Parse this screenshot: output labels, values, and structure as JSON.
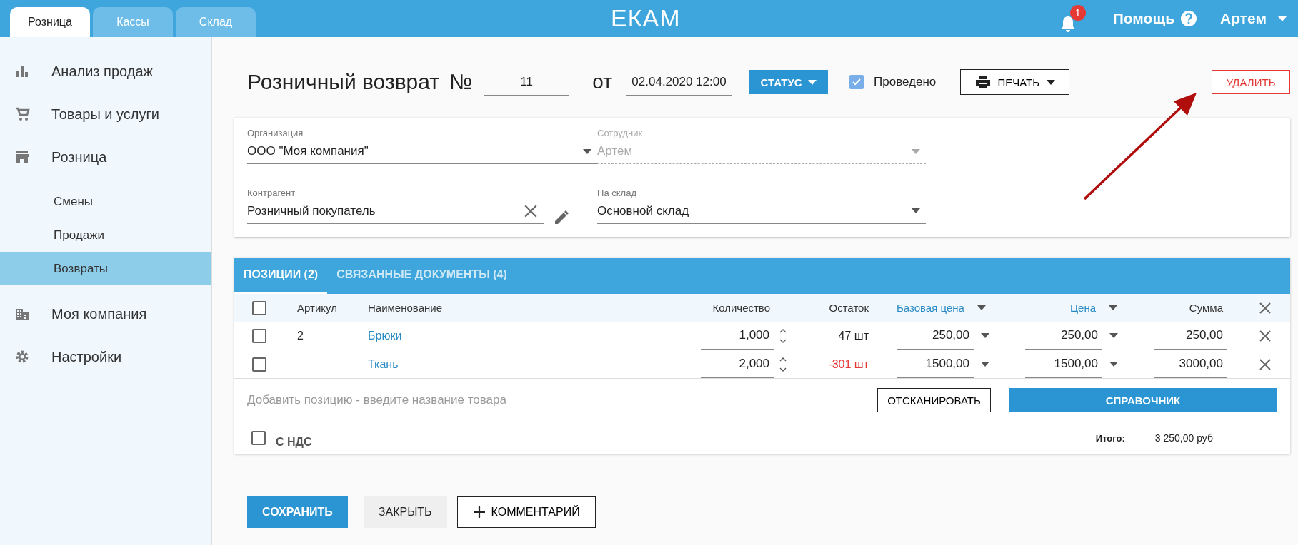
{
  "top_tabs": [
    {
      "label": "Розница",
      "selected": true
    },
    {
      "label": "Кассы",
      "selected": false
    },
    {
      "label": "Склад",
      "selected": false
    }
  ],
  "logo": "ЕКАМ",
  "notifications": {
    "count": "1"
  },
  "help": "Помощь",
  "user": "Артем",
  "sidebar": {
    "items": [
      {
        "label": "Анализ продаж",
        "selected": false
      },
      {
        "label": "Товары и услуги",
        "selected": false
      },
      {
        "label": "Розница",
        "selected": false,
        "children": [
          {
            "label": "Смены",
            "selected": false
          },
          {
            "label": "Продажи",
            "selected": false
          },
          {
            "label": "Возвраты",
            "selected": true
          }
        ]
      },
      {
        "label": "Моя компания",
        "selected": false
      },
      {
        "label": "Настройки",
        "selected": false
      }
    ]
  },
  "document": {
    "title": "Розничный возврат",
    "number_label": "№",
    "number": "11",
    "date_label": "от",
    "date": "02.04.2020 12:00",
    "status_button": "СТАТУС",
    "posted": {
      "label": "Проведено",
      "checked": true
    },
    "print_button": "ПЕЧАТЬ",
    "delete_button": "УДАЛИТЬ"
  },
  "form": {
    "fields": [
      {
        "label": "Организация",
        "value": "ООО \"Моя компания\"",
        "kind": "dropdown",
        "disabled": false
      },
      {
        "label": "Сотрудник",
        "value": "Артем",
        "kind": "dropdown",
        "disabled": true
      },
      {
        "label": "Контрагент",
        "value": "Розничный покупатель",
        "kind": "clearable",
        "disabled": false
      },
      {
        "label": "На склад",
        "value": "Основной склад",
        "kind": "dropdown",
        "disabled": false
      }
    ]
  },
  "positions": {
    "tabs": [
      {
        "label": "ПОЗИЦИИ (2)",
        "selected": true
      },
      {
        "label": "СВЯЗАННЫЕ ДОКУМЕНТЫ (4)",
        "selected": false
      }
    ],
    "select_all": {
      "checked": false
    },
    "columns": [
      {
        "label": "Артикул",
        "kind": "plain"
      },
      {
        "label": "Наименование",
        "kind": "plain"
      },
      {
        "label": "Количество",
        "kind": "plain"
      },
      {
        "label": "Остаток",
        "kind": "plain"
      },
      {
        "label": "Базовая цена",
        "kind": "menu"
      },
      {
        "label": "Цена",
        "kind": "menu"
      },
      {
        "label": "Сумма",
        "kind": "plain"
      }
    ],
    "rows": [
      {
        "checked": false,
        "article": "2",
        "name": "Брюки",
        "quantity": "1,000",
        "stock": "47 шт",
        "stock_negative": false,
        "base_price": "250,00",
        "price": "250,00",
        "sum": "250,00"
      },
      {
        "checked": false,
        "article": "",
        "name": "Ткань",
        "quantity": "2,000",
        "stock": "-301 шт",
        "stock_negative": true,
        "base_price": "1500,00",
        "price": "1500,00",
        "sum": "3000,00"
      }
    ],
    "add_placeholder": "Добавить позицию - введите название товара",
    "scan_button": "ОТСКАНИРОВАТЬ",
    "catalog_button": "СПРАВОЧНИК",
    "vat": {
      "label": "С НДС",
      "checked": false
    },
    "total_label": "Итого:",
    "total": "3 250,00 руб"
  },
  "buttons": [
    {
      "label": "СОХРАНИТЬ",
      "kind": "primary"
    },
    {
      "label": "ЗАКРЫТЬ",
      "kind": "flat"
    },
    {
      "label": "КОММЕНТАРИЙ",
      "kind": "add"
    }
  ]
}
